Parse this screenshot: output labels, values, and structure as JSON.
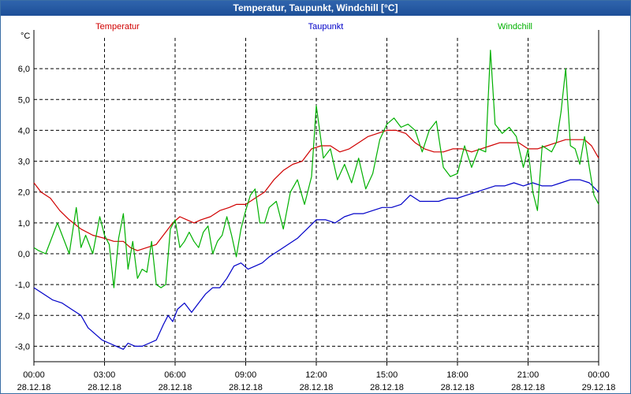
{
  "window": {
    "title": "Temperatur, Taupunkt, Windchill [°C]"
  },
  "colors": {
    "title_bar": "#1f53a0",
    "Temperatur": "#d00000",
    "Taupunkt": "#0000c8",
    "Windchill": "#00b000"
  },
  "chart_data": {
    "type": "line",
    "ylabel": "°C",
    "ylim": [
      -3.5,
      7.0
    ],
    "grid": true,
    "y_ticks": [
      "-3,0",
      "-2,0",
      "-1,0",
      "0,0",
      "1,0",
      "2,0",
      "3,0",
      "4,0",
      "5,0",
      "6,0"
    ],
    "x_ticks": [
      {
        "time": "00:00",
        "date": "28.12.18"
      },
      {
        "time": "03:00",
        "date": "28.12.18"
      },
      {
        "time": "06:00",
        "date": "28.12.18"
      },
      {
        "time": "09:00",
        "date": "28.12.18"
      },
      {
        "time": "12:00",
        "date": "28.12.18"
      },
      {
        "time": "15:00",
        "date": "28.12.18"
      },
      {
        "time": "18:00",
        "date": "28.12.18"
      },
      {
        "time": "21:00",
        "date": "28.12.18"
      },
      {
        "time": "00:00",
        "date": "29.12.18"
      }
    ],
    "xlim": [
      0,
      24
    ],
    "series": [
      {
        "name": "Temperatur",
        "color": "#d00000",
        "x": [
          0,
          0.3,
          0.7,
          1.1,
          1.5,
          2.0,
          2.5,
          3.0,
          3.4,
          3.8,
          4.1,
          4.4,
          4.8,
          5.2,
          5.5,
          5.9,
          6.2,
          6.5,
          6.8,
          7.1,
          7.5,
          7.9,
          8.3,
          8.6,
          9.0,
          9.4,
          9.8,
          10.2,
          10.6,
          11.0,
          11.4,
          11.8,
          12.2,
          12.6,
          13.0,
          13.4,
          13.8,
          14.2,
          14.6,
          15.0,
          15.4,
          15.8,
          16.2,
          16.6,
          17.0,
          17.4,
          17.8,
          18.2,
          18.6,
          19.0,
          19.4,
          19.8,
          20.2,
          20.6,
          21.0,
          21.4,
          21.8,
          22.2,
          22.6,
          23.0,
          23.4,
          23.7,
          24.0
        ],
        "values": [
          2.3,
          2.0,
          1.8,
          1.4,
          1.1,
          0.8,
          0.6,
          0.5,
          0.4,
          0.4,
          0.2,
          0.1,
          0.2,
          0.3,
          0.6,
          1.0,
          1.2,
          1.1,
          1.0,
          1.1,
          1.2,
          1.4,
          1.5,
          1.6,
          1.6,
          1.8,
          2.0,
          2.4,
          2.7,
          2.9,
          3.0,
          3.4,
          3.5,
          3.5,
          3.3,
          3.4,
          3.6,
          3.8,
          3.9,
          4.0,
          4.0,
          3.9,
          3.6,
          3.4,
          3.3,
          3.3,
          3.4,
          3.4,
          3.3,
          3.4,
          3.5,
          3.6,
          3.6,
          3.6,
          3.4,
          3.4,
          3.5,
          3.6,
          3.7,
          3.7,
          3.7,
          3.5,
          3.1
        ]
      },
      {
        "name": "Taupunkt",
        "color": "#0000c8",
        "x": [
          0,
          0.4,
          0.8,
          1.2,
          1.6,
          2.0,
          2.3,
          2.6,
          2.9,
          3.2,
          3.5,
          3.8,
          4.0,
          4.3,
          4.6,
          4.9,
          5.2,
          5.5,
          5.7,
          5.9,
          6.1,
          6.4,
          6.7,
          7.0,
          7.3,
          7.6,
          7.9,
          8.2,
          8.5,
          8.8,
          9.1,
          9.4,
          9.7,
          10.0,
          10.4,
          10.8,
          11.2,
          11.6,
          12.0,
          12.4,
          12.8,
          13.2,
          13.6,
          14.0,
          14.4,
          14.8,
          15.2,
          15.6,
          16.0,
          16.4,
          16.8,
          17.2,
          17.6,
          18.0,
          18.4,
          18.8,
          19.2,
          19.6,
          20.0,
          20.4,
          20.8,
          21.2,
          21.6,
          22.0,
          22.4,
          22.8,
          23.2,
          23.6,
          24.0
        ],
        "values": [
          -1.1,
          -1.3,
          -1.5,
          -1.6,
          -1.8,
          -2.0,
          -2.4,
          -2.6,
          -2.8,
          -2.9,
          -3.0,
          -3.1,
          -2.9,
          -3.0,
          -3.0,
          -2.9,
          -2.8,
          -2.3,
          -2.0,
          -2.2,
          -1.8,
          -1.6,
          -1.9,
          -1.6,
          -1.3,
          -1.1,
          -1.1,
          -0.8,
          -0.4,
          -0.3,
          -0.5,
          -0.4,
          -0.3,
          -0.1,
          0.1,
          0.3,
          0.5,
          0.8,
          1.1,
          1.1,
          1.0,
          1.2,
          1.3,
          1.3,
          1.4,
          1.5,
          1.5,
          1.6,
          1.9,
          1.7,
          1.7,
          1.7,
          1.8,
          1.8,
          1.9,
          2.0,
          2.1,
          2.2,
          2.2,
          2.3,
          2.2,
          2.3,
          2.2,
          2.2,
          2.3,
          2.4,
          2.4,
          2.3,
          2.0
        ]
      },
      {
        "name": "Windchill",
        "color": "#00b000",
        "x": [
          0,
          0.2,
          0.5,
          0.8,
          1.0,
          1.2,
          1.5,
          1.8,
          2.0,
          2.2,
          2.5,
          2.8,
          3.0,
          3.2,
          3.4,
          3.6,
          3.8,
          4.0,
          4.2,
          4.4,
          4.6,
          4.8,
          5.0,
          5.2,
          5.4,
          5.6,
          5.8,
          6.0,
          6.2,
          6.4,
          6.6,
          6.8,
          7.0,
          7.2,
          7.4,
          7.6,
          7.8,
          8.0,
          8.2,
          8.4,
          8.6,
          8.8,
          9.0,
          9.2,
          9.4,
          9.6,
          9.8,
          10.0,
          10.3,
          10.6,
          10.9,
          11.2,
          11.5,
          11.8,
          12.0,
          12.3,
          12.6,
          12.9,
          13.2,
          13.5,
          13.8,
          14.1,
          14.4,
          14.7,
          15.0,
          15.3,
          15.6,
          15.9,
          16.2,
          16.5,
          16.8,
          17.1,
          17.4,
          17.7,
          18.0,
          18.3,
          18.6,
          18.9,
          19.2,
          19.4,
          19.6,
          19.9,
          20.2,
          20.5,
          20.8,
          21.0,
          21.2,
          21.4,
          21.6,
          21.8,
          22.0,
          22.2,
          22.4,
          22.6,
          22.8,
          23.0,
          23.2,
          23.4,
          23.6,
          23.8,
          24.0
        ],
        "values": [
          0.2,
          0.1,
          0.0,
          0.6,
          1.0,
          0.6,
          0.0,
          1.5,
          0.2,
          0.6,
          0.0,
          1.2,
          0.6,
          0.3,
          -1.1,
          0.5,
          1.3,
          -0.5,
          0.4,
          -0.8,
          -0.5,
          -0.6,
          0.4,
          -1.0,
          -1.1,
          -1.0,
          0.8,
          1.1,
          0.2,
          0.4,
          0.7,
          0.4,
          0.2,
          0.7,
          0.9,
          0.0,
          0.4,
          0.6,
          1.2,
          0.6,
          -0.1,
          0.8,
          1.4,
          1.9,
          2.1,
          1.0,
          1.0,
          1.5,
          1.7,
          0.8,
          2.0,
          2.4,
          1.6,
          2.5,
          4.8,
          3.1,
          3.4,
          2.4,
          2.9,
          2.3,
          3.1,
          2.1,
          2.6,
          3.7,
          4.2,
          4.4,
          4.1,
          4.2,
          4.0,
          3.3,
          4.0,
          4.3,
          2.8,
          2.5,
          2.6,
          3.5,
          2.8,
          3.4,
          3.3,
          6.6,
          4.2,
          3.9,
          4.1,
          3.8,
          2.8,
          3.4,
          2.0,
          1.4,
          3.5,
          3.4,
          3.3,
          3.6,
          4.6,
          6.0,
          3.5,
          3.4,
          2.9,
          3.8,
          2.8,
          1.9,
          1.6
        ]
      }
    ]
  }
}
